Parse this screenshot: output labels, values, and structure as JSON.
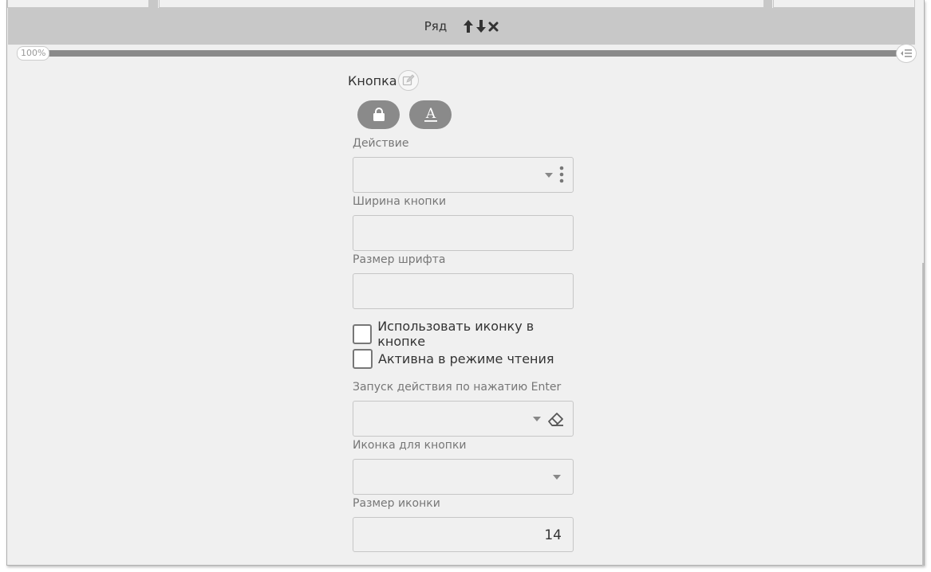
{
  "row": {
    "title": "Ряд"
  },
  "zoom": {
    "label": "100%"
  },
  "panel": {
    "title": "Кнопка",
    "fields": {
      "action": {
        "label": "Действие",
        "value": ""
      },
      "button_width": {
        "label": "Ширина кнопки",
        "value": ""
      },
      "font_size": {
        "label": "Размер шрифта",
        "value": ""
      },
      "enter_action": {
        "label": "Запуск действия по нажатию Enter",
        "value": ""
      },
      "button_icon": {
        "label": "Иконка для кнопки",
        "value": ""
      },
      "icon_size": {
        "label": "Размер иконки",
        "value": "14"
      }
    },
    "checkboxes": {
      "use_icon": {
        "label": "Использовать иконку в кнопке",
        "checked": false
      },
      "read_mode": {
        "label": "Активна в режиме чтения",
        "checked": false
      }
    },
    "icons": [
      "edit-icon",
      "lock-icon",
      "text-format-icon",
      "menu-dots-icon",
      "eraser-icon",
      "arrow-up-icon",
      "arrow-down-icon",
      "close-icon",
      "list-icon"
    ]
  }
}
